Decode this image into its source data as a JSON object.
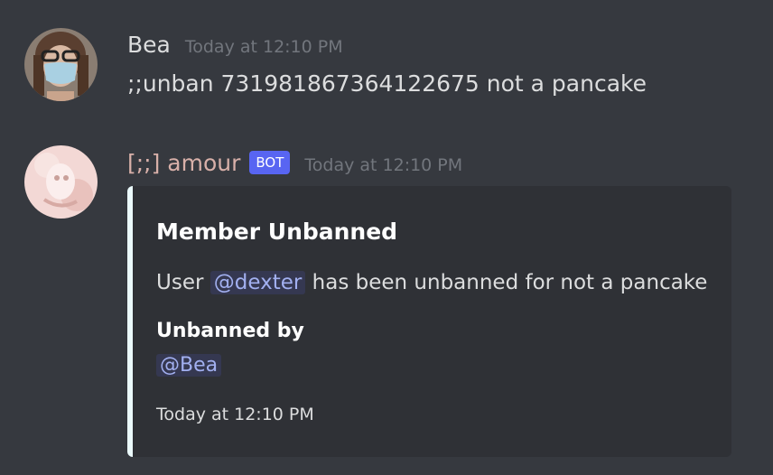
{
  "messages": [
    {
      "author": "Bea",
      "avatar_icon": "masked-person-avatar",
      "timestamp": "Today at 12:10 PM",
      "content": ";;unban 731981867364122675 not a pancake"
    },
    {
      "author": "[;;] amour",
      "bot_tag": "BOT",
      "avatar_icon": "pink-bot-avatar",
      "timestamp": "Today at 12:10 PM",
      "embed": {
        "accent_color": "#ebfafc",
        "title": "Member Unbanned",
        "description_prefix": "User",
        "description_mention": "@dexter",
        "description_suffix": "has been unbanned for not a pancake",
        "field_name": "Unbanned by",
        "field_value": "@Bea",
        "footer": "Today at 12:10 PM"
      }
    }
  ],
  "colors": {
    "background": "#36393f",
    "embed_background": "#2f3136",
    "bot_tag": "#5865f2",
    "mention": "#a2b0f0"
  }
}
